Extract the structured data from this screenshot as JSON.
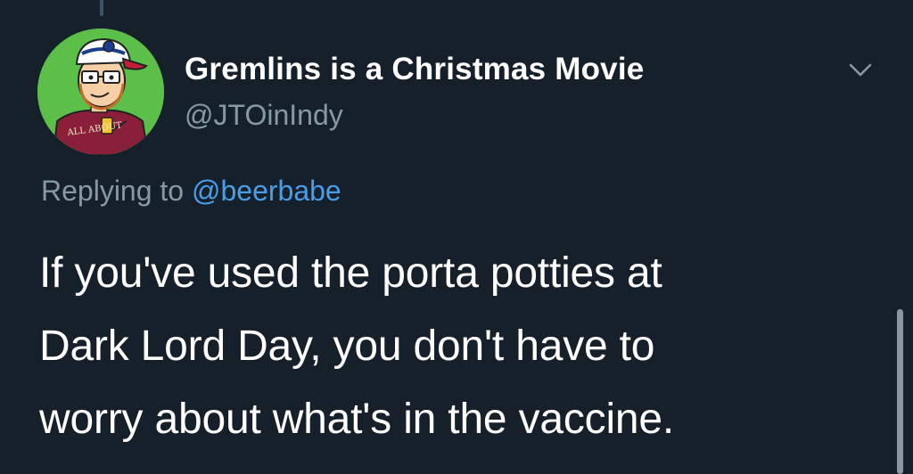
{
  "tweet": {
    "display_name": "Gremlins is a Christmas Movie",
    "handle": "@JTOinIndy",
    "reply_prefix": "Replying to ",
    "reply_mention": "@beerbabe",
    "text_lines": [
      "If you've used the porta potties at",
      "Dark Lord Day, you don't have to",
      "worry about what's in the vaccine."
    ],
    "avatar_shirt_text": "ALL ABOUT"
  },
  "icons": {
    "menu": "chevron-down-icon",
    "avatar": "avatar"
  },
  "colors": {
    "background": "#15202b",
    "primary_text": "#ffffff",
    "secondary_text": "#8899a6",
    "link": "#4a9ee8",
    "avatar_bg": "#5cbf4a"
  }
}
